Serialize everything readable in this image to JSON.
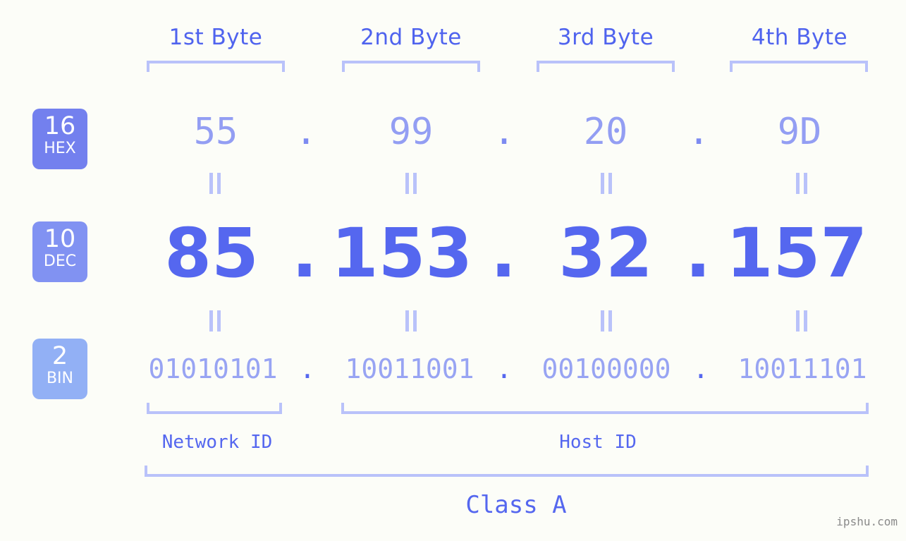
{
  "meta": {
    "background_color": "#fcfdf8",
    "accent_color": "#5567ef",
    "bracket_color": "#b9c2fa",
    "watermark": "ipshu.com"
  },
  "byte_headers": [
    {
      "label": "1st Byte"
    },
    {
      "label": "2nd Byte"
    },
    {
      "label": "3rd Byte"
    },
    {
      "label": "4th Byte"
    }
  ],
  "radix_badges": [
    {
      "number": "16",
      "name": "HEX",
      "color": "#7380ee"
    },
    {
      "number": "10",
      "name": "DEC",
      "color": "#8192f2"
    },
    {
      "number": "2",
      "name": "BIN",
      "color": "#92b0f5"
    }
  ],
  "rows": {
    "hex": {
      "radix": "16",
      "values": [
        "55",
        "99",
        "20",
        "9D"
      ],
      "separator": "."
    },
    "dec": {
      "radix": "10",
      "values": [
        "85",
        "153",
        "32",
        "157"
      ],
      "separator": "."
    },
    "bin": {
      "radix": "2",
      "values": [
        "01010101",
        "10011001",
        "00100000",
        "10011101"
      ],
      "separator": "."
    }
  },
  "equality_marks": {
    "glyph": "=",
    "hex_to_dec_count": 4,
    "dec_to_bin_count": 4
  },
  "sections": {
    "network_id": "Network ID",
    "host_id": "Host ID",
    "class": "Class A"
  },
  "ip_summary": {
    "decimal": "85.153.32.157",
    "hexadecimal": "55.99.20.9D",
    "binary": "01010101.10011001.00100000.10011101",
    "class": "Class A",
    "network_id_bytes": 1,
    "host_id_bytes": 3
  }
}
